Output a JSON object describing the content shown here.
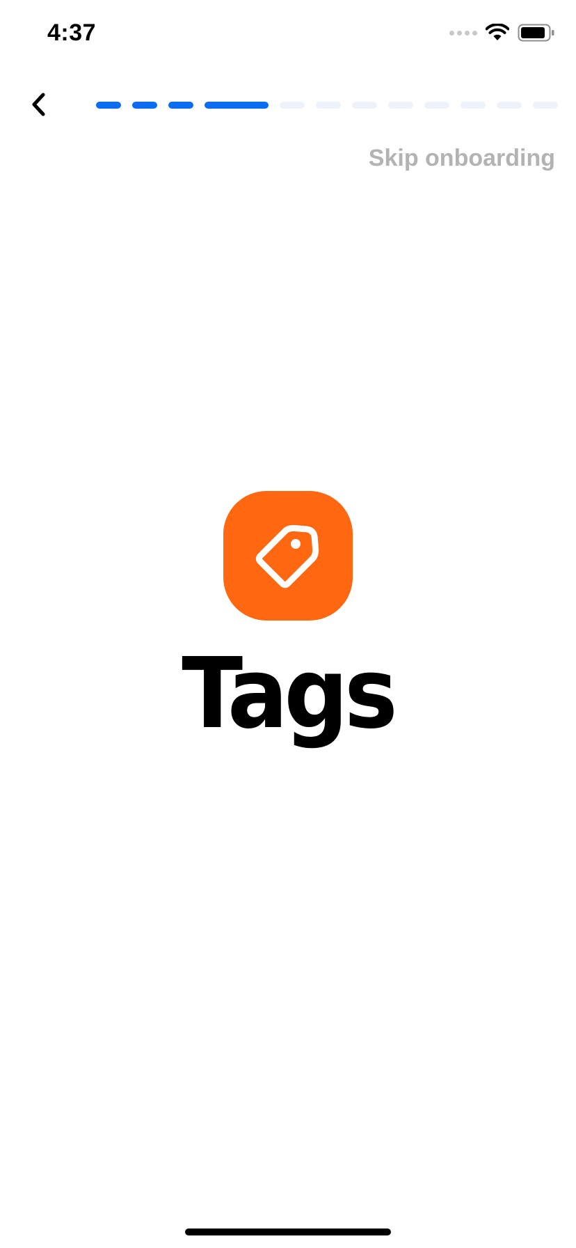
{
  "status_bar": {
    "time": "4:37"
  },
  "icons": {
    "back": "chevron-left-icon",
    "wifi": "wifi-icon",
    "battery": "battery-icon",
    "cellular": "cellular-signal-icon",
    "app": "tag-icon"
  },
  "progress": {
    "total_steps": 12,
    "completed_steps": 4,
    "color_done": "#0a6cf0",
    "color_todo": "#eef3fb"
  },
  "header": {
    "skip_label": "Skip onboarding"
  },
  "hero": {
    "title": "Tags",
    "icon_color": "#ff6811"
  }
}
